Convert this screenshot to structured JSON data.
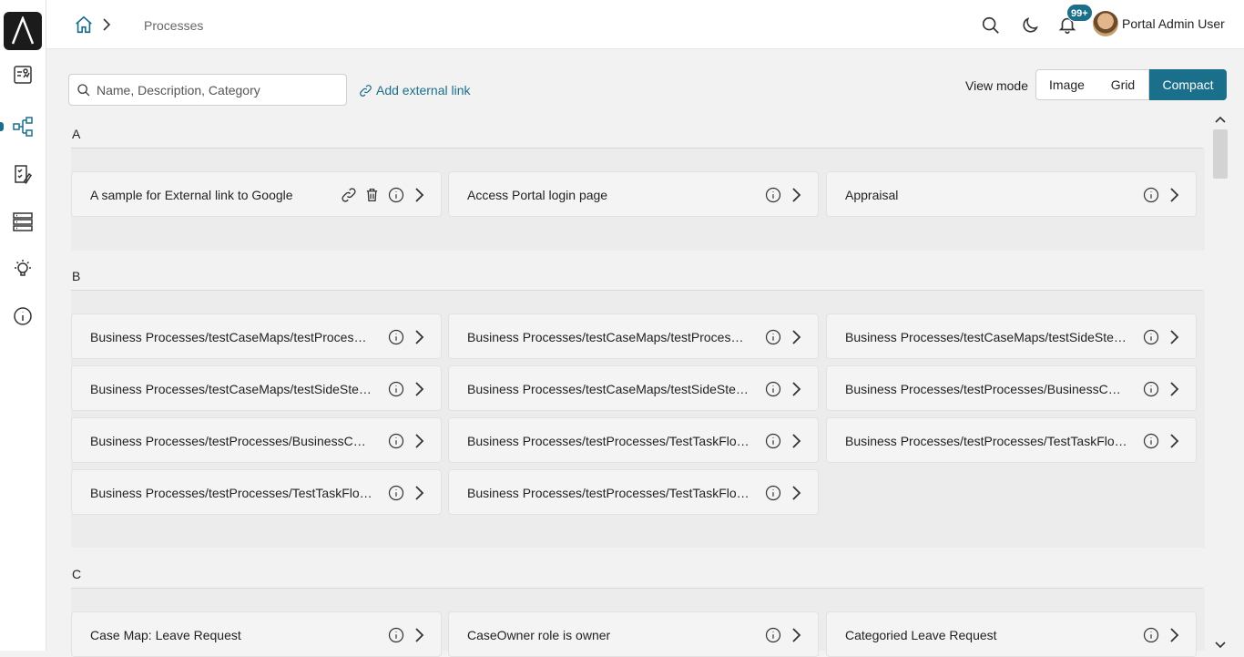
{
  "breadcrumb": {
    "current": "Processes"
  },
  "header": {
    "notification_count": "99+",
    "user_name": "Portal Admin User"
  },
  "toolbar": {
    "search_placeholder": "Name, Description, Category",
    "add_external_link": "Add external link",
    "view_mode_label": "View mode",
    "view_modes": [
      "Image",
      "Grid",
      "Compact"
    ],
    "selected_view_mode": "Compact"
  },
  "groups": [
    {
      "letter": "A",
      "items": [
        {
          "label": "A sample for External link to Google",
          "external": true
        },
        {
          "label": "Access Portal login page",
          "external": false
        },
        {
          "label": "Appraisal",
          "external": false
        }
      ]
    },
    {
      "letter": "B",
      "items": [
        {
          "label": "Business Processes/testCaseMaps/testProcesses/...",
          "external": false
        },
        {
          "label": "Business Processes/testCaseMaps/testProcesses/...",
          "external": false
        },
        {
          "label": "Business Processes/testCaseMaps/testSideSteps/...",
          "external": false
        },
        {
          "label": "Business Processes/testCaseMaps/testSideSteps/...",
          "external": false
        },
        {
          "label": "Business Processes/testCaseMaps/testSideSteps/...",
          "external": false
        },
        {
          "label": "Business Processes/testProcesses/BusinessCases/...",
          "external": false
        },
        {
          "label": "Business Processes/testProcesses/BusinessCases/...",
          "external": false
        },
        {
          "label": "Business Processes/testProcesses/TestTaskFlow/C...",
          "external": false
        },
        {
          "label": "Business Processes/testProcesses/TestTaskFlow/I...",
          "external": false
        },
        {
          "label": "Business Processes/testProcesses/TestTaskFlow/S...",
          "external": false
        },
        {
          "label": "Business Processes/testProcesses/TestTaskFlow/l...",
          "external": false
        }
      ]
    },
    {
      "letter": "C",
      "items": [
        {
          "label": "Case Map: Leave Request",
          "external": false
        },
        {
          "label": "CaseOwner role is owner",
          "external": false
        },
        {
          "label": "Categoried Leave Request",
          "external": false
        }
      ]
    }
  ],
  "colors": {
    "accent": "#1a6f8a",
    "background": "#f2f2f2"
  }
}
